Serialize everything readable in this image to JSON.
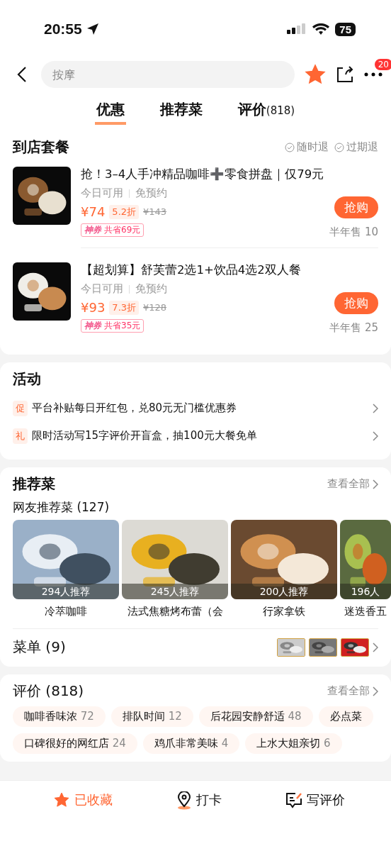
{
  "status_bar": {
    "time": "20:55",
    "battery": "75"
  },
  "nav": {
    "search": {
      "placeholder": "按摩"
    },
    "favorited": true,
    "badge": "20"
  },
  "tabs": [
    {
      "label": "优惠",
      "selected": true
    },
    {
      "label": "推荐菜",
      "selected": false
    },
    {
      "label": "评价",
      "count": "(818)",
      "selected": false
    }
  ],
  "deals": {
    "title": "到店套餐",
    "guarantees": [
      "随时退",
      "过期退"
    ],
    "items": [
      {
        "title": "抢！3–4人手冲精品咖啡➕零食拼盘｜仅79元",
        "tags": [
          "今日可用",
          "免预约"
        ],
        "price": "¥74",
        "discount": "5.2折",
        "original": "¥143",
        "coupon_label": "神券",
        "coupon": "共省69元",
        "button": "抢购",
        "sold": "半年售 10"
      },
      {
        "title": "【超划算】舒芙蕾2选1+饮品4选2双人餐",
        "tags": [
          "今日可用",
          "免预约"
        ],
        "price": "¥93",
        "discount": "7.3折",
        "original": "¥128",
        "coupon_label": "神券",
        "coupon": "共省35元",
        "button": "抢购",
        "sold": "半年售 25"
      }
    ]
  },
  "activities": {
    "title": "活动",
    "items": [
      {
        "badge": "促",
        "text": "平台补贴每日开红包，兑80元无门槛优惠券"
      },
      {
        "badge": "礼",
        "text": "限时活动写15字评价开盲盒，抽100元大餐免单"
      }
    ]
  },
  "dishes": {
    "title": "推荐菜",
    "more": "查看全部",
    "subtitle": "网友推荐菜 (127)",
    "items": [
      {
        "count": "294人推荐",
        "name": "冷萃咖啡"
      },
      {
        "count": "245人推荐",
        "name": "法式焦糖烤布蕾（会"
      },
      {
        "count": "200人推荐",
        "name": "行家拿铁"
      },
      {
        "count": "196人",
        "name": "迷迭香五"
      }
    ],
    "menu": "菜单 (9)"
  },
  "reviews": {
    "title": "评价 (818)",
    "more": "查看全部",
    "tag_rows": [
      [
        {
          "text": "咖啡香味浓",
          "count": "72"
        },
        {
          "text": "排队时间",
          "count": "12"
        },
        {
          "text": "后花园安静舒适",
          "count": "48"
        },
        {
          "text": "必点菜"
        }
      ],
      [
        {
          "text": "口碑很好的网红店",
          "count": "24"
        },
        {
          "text": "鸡爪非常美味",
          "count": "4"
        },
        {
          "text": "上水大姐亲切",
          "count": "6"
        }
      ]
    ]
  },
  "bottom_bar": [
    {
      "kind": "star",
      "label": "已收藏",
      "active": true
    },
    {
      "kind": "pin",
      "label": "打卡",
      "active": false
    },
    {
      "kind": "write",
      "label": "写评价",
      "active": false
    }
  ]
}
